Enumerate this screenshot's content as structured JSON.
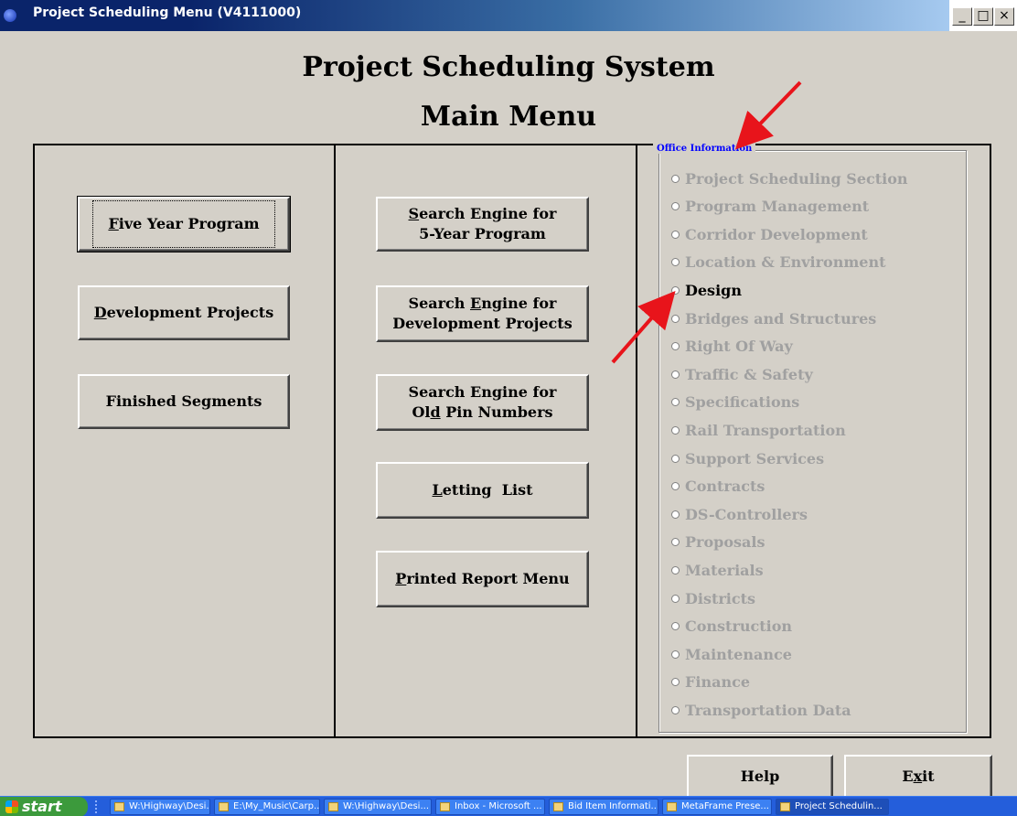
{
  "window": {
    "title": "Project Scheduling Menu  (V4111000)",
    "minimize_glyph": "_",
    "maximize_glyph": "□",
    "close_glyph": "×"
  },
  "header": {
    "title": "Project Scheduling System",
    "subtitle": "Main Menu"
  },
  "left_buttons": [
    {
      "label": "Five Year Program",
      "mnemonic": "F"
    },
    {
      "label": "Development Projects",
      "mnemonic": "D"
    },
    {
      "label": "Finished Segments"
    }
  ],
  "middle_buttons": [
    {
      "line1": "Search Engine for",
      "line2": "5-Year Program"
    },
    {
      "line1": "Search Engine for",
      "line2": "Development Projects"
    },
    {
      "line1": "Search Engine for",
      "line2": "Old Pin Numbers"
    },
    {
      "label": "Letting  List"
    },
    {
      "label": "Printed Report Menu"
    }
  ],
  "office_group": {
    "label": "Office Information",
    "options": [
      {
        "label": "Project Scheduling Section",
        "enabled": false
      },
      {
        "label": "Program Management",
        "enabled": false
      },
      {
        "label": "Corridor Development",
        "enabled": false
      },
      {
        "label": "Location & Environment",
        "enabled": false
      },
      {
        "label": "Design",
        "enabled": true
      },
      {
        "label": "Bridges and Structures",
        "enabled": false
      },
      {
        "label": "Right Of Way",
        "enabled": false
      },
      {
        "label": "Traffic & Safety",
        "enabled": false
      },
      {
        "label": "Specifications",
        "enabled": false
      },
      {
        "label": "Rail Transportation",
        "enabled": false
      },
      {
        "label": "Support Services",
        "enabled": false
      },
      {
        "label": "Contracts",
        "enabled": false
      },
      {
        "label": "DS-Controllers",
        "enabled": false
      },
      {
        "label": "Proposals",
        "enabled": false
      },
      {
        "label": "Materials",
        "enabled": false
      },
      {
        "label": "Districts",
        "enabled": false
      },
      {
        "label": "Construction",
        "enabled": false
      },
      {
        "label": "Maintenance",
        "enabled": false
      },
      {
        "label": "Finance",
        "enabled": false
      },
      {
        "label": "Transportation Data",
        "enabled": false
      }
    ]
  },
  "footer_buttons": {
    "help": "Help",
    "exit": "Exit"
  },
  "taskbar": {
    "start_label": "start",
    "tasks": [
      "W:\\Highway\\Desi...",
      "E:\\My_Music\\Carp...",
      "W:\\Highway\\Desi...",
      "Inbox - Microsoft ...",
      "Bid Item Informati...",
      "MetaFrame Prese...",
      "Project Schedulin..."
    ]
  },
  "colors": {
    "dialog_bg": "#d4d0c8",
    "titlebar_blue": "#0a246a",
    "group_label_blue": "#0000ff",
    "disabled_text": "#a0a0a0",
    "annotation_arrow": "#e8141b"
  }
}
